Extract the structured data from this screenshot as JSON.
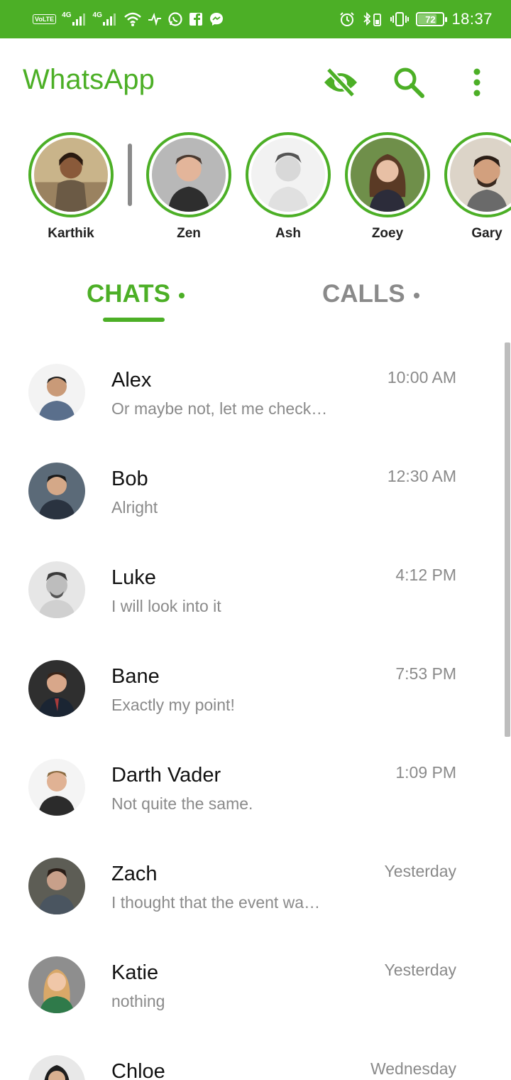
{
  "status_bar": {
    "time": "18:37",
    "battery": "72",
    "volte": "VoLTE",
    "net1": "4G",
    "net2": "4G",
    "background": "#4caf26"
  },
  "app": {
    "title": "WhatsApp",
    "accent": "#4caf26"
  },
  "toolbar": {
    "icons": [
      "eye-off-icon",
      "search-icon",
      "more-vert-icon"
    ]
  },
  "stories": [
    {
      "name": "Karthik"
    },
    {
      "name": "Zen"
    },
    {
      "name": "Ash"
    },
    {
      "name": "Zoey"
    },
    {
      "name": "Gary"
    }
  ],
  "tabs": {
    "chats": "CHATS",
    "calls": "CALLS",
    "active": "CHATS"
  },
  "chats": [
    {
      "name": "Alex",
      "message": "Or maybe not, let me check…",
      "time": "10:00 AM"
    },
    {
      "name": "Bob",
      "message": "Alright",
      "time": "12:30 AM"
    },
    {
      "name": "Luke",
      "message": "I will look into it",
      "time": "4:12 PM"
    },
    {
      "name": "Bane",
      "message": "Exactly my point!",
      "time": "7:53 PM"
    },
    {
      "name": "Darth Vader",
      "message": "Not quite the same.",
      "time": "1:09 PM"
    },
    {
      "name": "Zach",
      "message": "I thought that the event wa…",
      "time": "Yesterday"
    },
    {
      "name": "Katie",
      "message": "nothing",
      "time": "Yesterday"
    },
    {
      "name": "Chloe",
      "message": "",
      "time": "Wednesday"
    }
  ]
}
